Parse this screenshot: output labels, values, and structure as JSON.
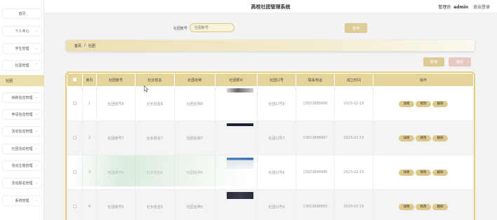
{
  "header": {
    "title": "高校社团管理系统",
    "role": "管理员",
    "username": "admin",
    "logout": "退出登录"
  },
  "sidebar": {
    "items": [
      {
        "label": "首页",
        "has_arrow": false
      },
      {
        "label": "个人中心",
        "has_arrow": true
      },
      {
        "label": "学生管理",
        "has_arrow": true
      },
      {
        "label": "社团管理",
        "has_arrow": true,
        "expanded": true
      },
      {
        "label": "纳新信息管理",
        "has_arrow": true
      },
      {
        "label": "申请信息管理",
        "has_arrow": true
      },
      {
        "label": "活动信息管理",
        "has_arrow": true
      },
      {
        "label": "社团活动管理",
        "has_arrow": true
      },
      {
        "label": "活动主题管理",
        "has_arrow": true
      },
      {
        "label": "活动报名管理",
        "has_arrow": true
      },
      {
        "label": "系统管理",
        "has_arrow": true
      }
    ],
    "active_sub": "社团"
  },
  "search": {
    "label": "社团账号",
    "placeholder": "社团账号",
    "button": "查询"
  },
  "breadcrumb": {
    "home": "首页",
    "separator": "/",
    "current": "社团"
  },
  "actions": {
    "add": "新增",
    "delete": "删除"
  },
  "table": {
    "columns": [
      "索引",
      "社团账号",
      "社长姓名",
      "社团名称",
      "社团照片",
      "社团口号",
      "联系电话",
      "成立时间",
      "操作"
    ],
    "rows": [
      {
        "index": "1",
        "account": "社团账号8",
        "leader": "社长姓名8",
        "name": "社团名称8",
        "slogan": "社团口号8",
        "phone": "13823888888",
        "date": "2023-02-15"
      },
      {
        "index": "2",
        "account": "社团账号7",
        "leader": "社长姓名7",
        "name": "社团名称7",
        "slogan": "社团口号7",
        "phone": "13823888887",
        "date": "2023-02-15"
      },
      {
        "index": "3",
        "account": "社团账号6",
        "leader": "社长姓名6",
        "name": "社团名称6",
        "slogan": "社团口号6",
        "phone": "13823888886",
        "date": "2023-02-15"
      },
      {
        "index": "4",
        "account": "社团账号5",
        "leader": "社长姓名5",
        "name": "社团名称5",
        "slogan": "社团口号5",
        "phone": "13823888885",
        "date": "2023-02-15"
      }
    ],
    "row_actions": {
      "detail": "详情",
      "edit": "修改",
      "delete": "删除"
    }
  },
  "colors": {
    "accent": "#e6d59a",
    "accent_border": "#e4d07e",
    "active_sidebar": "#ecdfae",
    "delete_button": "#e8c8c2"
  },
  "icons": {
    "expand": "chevron-down-icon",
    "collapse": "chevron-up-icon",
    "cursor": "mouse-pointer-icon"
  }
}
